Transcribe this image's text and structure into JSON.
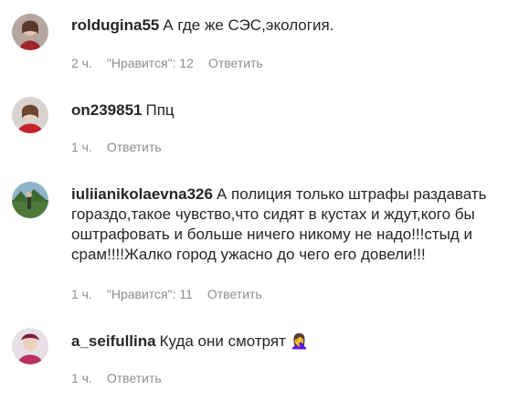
{
  "comments": [
    {
      "username": "roldugina55",
      "text": "А где же СЭС,экология.",
      "time": "2 ч.",
      "likes": "\"Нравится\": 12",
      "reply": "Ответить"
    },
    {
      "username": "on239851",
      "text": "Ппц",
      "time": "1 ч.",
      "reply": "Ответить"
    },
    {
      "username": "iuliianikolaevna326",
      "text": "А полиция только штрафы раздавать гораздо,такое чувство,что сидят в кустах и ждут,кого бы оштрафовать и больше ничего никому не надо!!!стыд и срам!!!!Жалко город ужасно до чего его довели!!!",
      "time": "1 ч.",
      "likes": "\"Нравится\": 11",
      "reply": "Ответить"
    },
    {
      "username": "a_seifullina",
      "text": "Куда они смотрят",
      "emoji": "🤦‍♀️",
      "time": "1 ч.",
      "reply": "Ответить"
    }
  ]
}
